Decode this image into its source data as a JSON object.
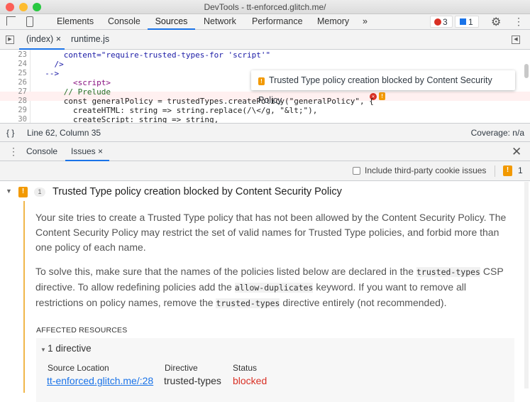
{
  "window": {
    "title": "DevTools - tt-enforced.glitch.me/"
  },
  "toolbar": {
    "tabs": [
      "Elements",
      "Console",
      "Sources",
      "Network",
      "Performance",
      "Memory"
    ],
    "more": "»",
    "errors": "3",
    "messages": "1"
  },
  "files": {
    "tabs": [
      "(index)",
      "runtime.js"
    ]
  },
  "code": {
    "lines": [
      {
        "n": "23",
        "text": "      content=\"require-trusted-types-for 'script'\""
      },
      {
        "n": "24",
        "text": "    />"
      },
      {
        "n": "25",
        "text": "  -->"
      },
      {
        "n": "26",
        "text": "        <script>"
      },
      {
        "n": "27",
        "text": "      // Prelude"
      },
      {
        "n": "28",
        "text": "      const generalPolicy = trustedTypes.createPolicy(\"generalPolicy\", {"
      },
      {
        "n": "29",
        "text": "        createHTML: string => string.replace(/\\</g, \"&lt;\"),"
      },
      {
        "n": "30",
        "text": "        createScript: string => string,"
      }
    ],
    "tooltip": "Trusted Type policy creation blocked by Content Security Policy"
  },
  "status": {
    "position": "Line 62, Column 35",
    "coverage": "Coverage: n/a"
  },
  "drawer": {
    "tabs": [
      "Console",
      "Issues"
    ]
  },
  "issues": {
    "checkbox_label": "Include third-party cookie issues",
    "count": "1",
    "title": "Trusted Type policy creation blocked by Content Security Policy",
    "occurrences": "1",
    "p1": "Your site tries to create a Trusted Type policy that has not been allowed by the Content Security Policy. The Content Security Policy may restrict the set of valid names for Trusted Type policies, and forbid more than one policy of each name.",
    "p2a": "To solve this, make sure that the names of the policies listed below are declared in the ",
    "p2code1": "trusted-types",
    "p2b": " CSP directive. To allow redefining policies add the ",
    "p2code2": "allow-duplicates",
    "p2c": " keyword. If you want to remove all restrictions on policy names, remove the ",
    "p2code3": "trusted-types",
    "p2d": " directive entirely (not recommended).",
    "affected": "AFFECTED RESOURCES",
    "directive_count": "1 directive",
    "columns": [
      "Source Location",
      "Directive",
      "Status"
    ],
    "row": {
      "source": "tt-enforced.glitch.me/:28",
      "directive": "trusted-types",
      "status": "blocked"
    }
  },
  "colors": {
    "accent": "#1a73e8",
    "warning": "#f29900",
    "error": "#d93025"
  }
}
